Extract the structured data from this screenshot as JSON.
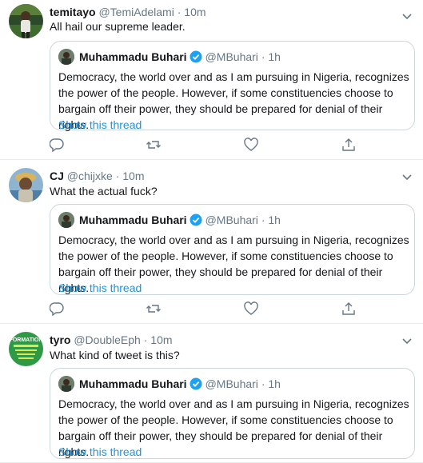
{
  "tweets": [
    {
      "name": "temitayo",
      "handle": "@TemiAdelami",
      "dot": "·",
      "time": "10m",
      "text": "All hail our supreme leader.",
      "quote": {
        "name": "Muhammadu Buhari",
        "handle": "@MBuhari",
        "dot": "·",
        "time": "1h",
        "text": "Democracy, the world over and as I am pursuing in Nigeria, recognizes the power of the people. However, if some constituencies choose to bargain off their power, they should be prepared for denial of their rights.",
        "link": "Show this thread"
      }
    },
    {
      "name": "CJ",
      "handle": "@chijxke",
      "dot": "·",
      "time": "10m",
      "text": "What the actual fuck?",
      "quote": {
        "name": "Muhammadu Buhari",
        "handle": "@MBuhari",
        "dot": "·",
        "time": "1h",
        "text": "Democracy, the world over and as I am pursuing in Nigeria, recognizes the power of the people. However, if some constituencies choose to bargain off their power, they should be prepared for denial of their rights.",
        "link": "Show this thread"
      }
    },
    {
      "name": "tyro",
      "handle": "@DoubleEph",
      "dot": "·",
      "time": "10m",
      "text": "What kind of tweet is this?",
      "avatar_text": "FORMATION",
      "quote": {
        "name": "Muhammadu Buhari",
        "handle": "@MBuhari",
        "dot": "·",
        "time": "1h",
        "text": "Democracy, the world over and as I am pursuing in Nigeria, recognizes the power of the people. However, if some constituencies choose to bargain off their power, they should be prepared for denial of their rights.",
        "link": "Show this thread"
      }
    }
  ],
  "colors": {
    "link": "#1b95e0",
    "muted": "#657786",
    "border": "#ccd6dd",
    "verified": "#1da1f2",
    "icon": "#657786"
  },
  "icons": [
    "reply-icon",
    "retweet-icon",
    "like-icon",
    "share-icon",
    "chevron-down-icon",
    "verified-badge-icon"
  ]
}
